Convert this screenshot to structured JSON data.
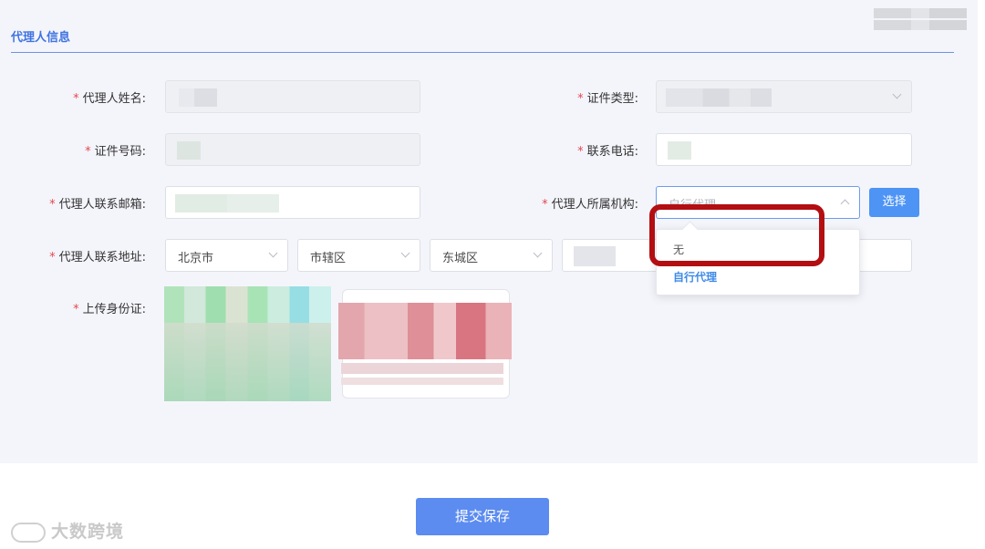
{
  "section": {
    "title": "代理人信息"
  },
  "fields": {
    "name_label": "代理人姓名:",
    "id_type_label": "证件类型:",
    "id_number_label": "证件号码:",
    "phone_label": "联系电话:",
    "email_label": "代理人联系邮箱:",
    "org_label": "代理人所属机构:",
    "org_placeholder": "自行代理",
    "address_label": "代理人联系地址:",
    "province": "北京市",
    "city": "市辖区",
    "district": "东城区",
    "id_upload_label": "上传身份证:",
    "required_mark": "*"
  },
  "actions": {
    "choose": "选择",
    "submit": "提交保存"
  },
  "dropdown": {
    "options": [
      "无",
      "自行代理"
    ],
    "selected_index": 1
  },
  "watermark": {
    "text": "大数跨境"
  },
  "colors": {
    "accent": "#3f73e0",
    "button": "#4d94f5",
    "submit": "#5c8cf0",
    "required": "#e5484d",
    "highlight": "#b30e12"
  }
}
